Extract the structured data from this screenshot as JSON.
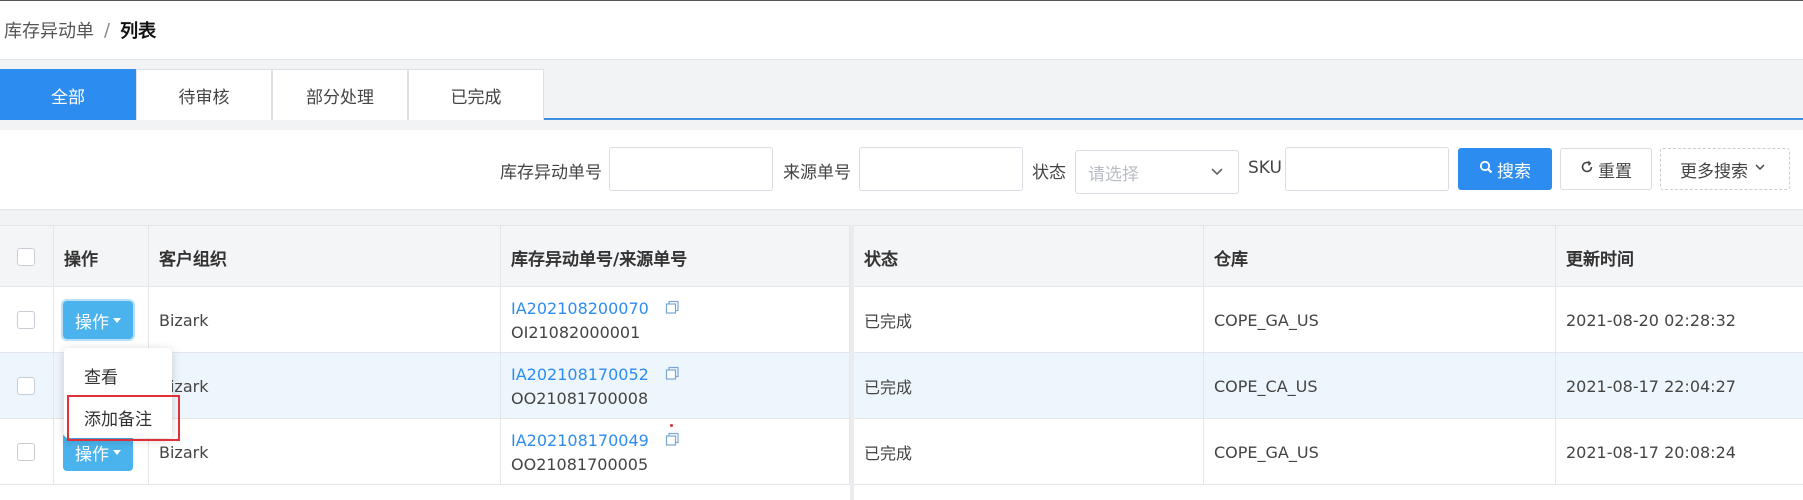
{
  "breadcrumb": {
    "parent": "库存异动单",
    "separator": "/",
    "current": "列表"
  },
  "tabs": [
    {
      "label": "全部",
      "active": true
    },
    {
      "label": "待审核",
      "active": false
    },
    {
      "label": "部分处理",
      "active": false
    },
    {
      "label": "已完成",
      "active": false
    }
  ],
  "search": {
    "movement_no_label": "库存异动单号",
    "movement_no_value": "",
    "source_no_label": "来源单号",
    "source_no_value": "",
    "status_label": "状态",
    "status_placeholder": "请选择",
    "sku_label": "SKU",
    "sku_value": "",
    "search_button": "搜索",
    "reset_button": "重置",
    "more_search_button": "更多搜索"
  },
  "table": {
    "headers": {
      "operation": "操作",
      "customer_org": "客户组织",
      "numbers": "库存异动单号/来源单号",
      "status": "状态",
      "warehouse": "仓库",
      "updated_at": "更新时间"
    },
    "op_button_label": "操作",
    "rows": [
      {
        "customer": "Bizark",
        "movement_no": "IA202108200070",
        "source_no": "OI21082000001",
        "status": "已完成",
        "warehouse": "COPE_GA_US",
        "updated_at": "2021-08-20 02:28:32"
      },
      {
        "customer": "Bizark",
        "movement_no": "IA202108170052",
        "source_no": "OO21081700008",
        "status": "已完成",
        "warehouse": "COPE_CA_US",
        "updated_at": "2021-08-17 22:04:27"
      },
      {
        "customer": "Bizark",
        "movement_no": "IA202108170049",
        "source_no": "OO21081700005",
        "status": "已完成",
        "warehouse": "COPE_GA_US",
        "updated_at": "2021-08-17 20:08:24"
      }
    ]
  },
  "dropdown": {
    "items": [
      "查看",
      "添加备注"
    ]
  },
  "colors": {
    "primary": "#2d8cf0",
    "op_button": "#4ab2ec",
    "highlight_border": "#e0303a",
    "row_hover": "#eef6fd"
  }
}
